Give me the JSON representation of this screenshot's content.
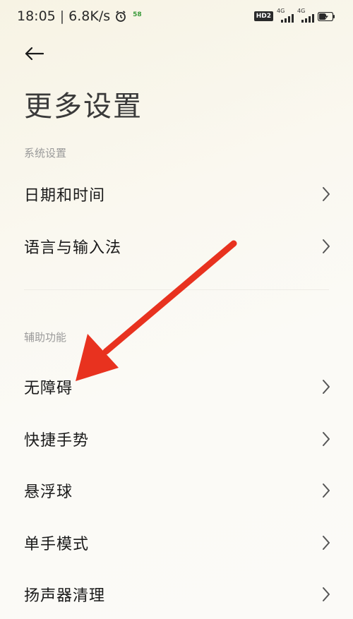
{
  "status_bar": {
    "time": "18:05",
    "separator": "|",
    "network_speed": "6.8K/s",
    "alarm_icon": "alarm-clock-icon",
    "notification_badge": "58",
    "hd_badge": "HD2",
    "signal1_label": "4G",
    "signal2_label": "4G",
    "battery_icon": "battery-charging-icon"
  },
  "header": {
    "back_icon": "arrow-left-icon",
    "title": "更多设置"
  },
  "sections": [
    {
      "header": "系统设置",
      "items": [
        {
          "label": "日期和时间"
        },
        {
          "label": "语言与输入法"
        }
      ]
    },
    {
      "header": "辅助功能",
      "items": [
        {
          "label": "无障碍"
        },
        {
          "label": "快捷手势"
        },
        {
          "label": "悬浮球"
        },
        {
          "label": "单手模式"
        },
        {
          "label": "扬声器清理"
        }
      ]
    }
  ],
  "annotation": {
    "type": "red-arrow",
    "color": "#e8321f",
    "points_to": "无障碍"
  },
  "colors": {
    "background": "#faf8f0",
    "title": "#3a3a3a",
    "section_header": "#9a9a9a",
    "item_text": "#1a1a1a",
    "chevron": "#555555"
  }
}
